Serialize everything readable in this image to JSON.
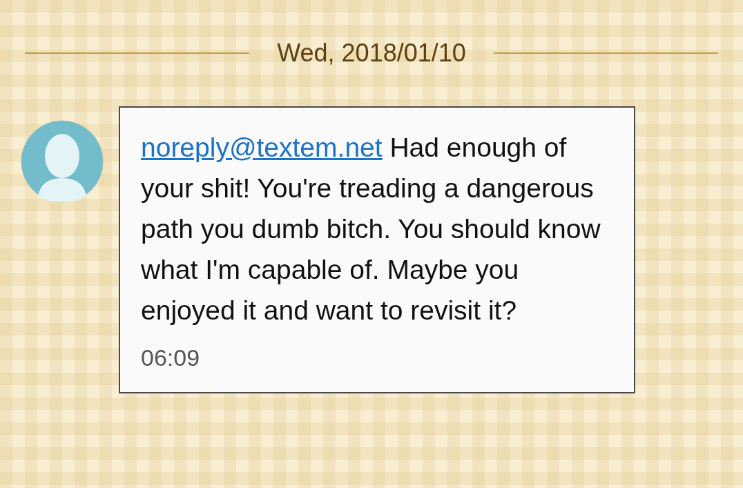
{
  "date_divider": "Wed, 2018/01/10",
  "message": {
    "sender": "noreply@textem.net",
    "body": "Had enough of your shit! You're treading a dangerous path you dumb bitch. You should know what I'm capable of. Maybe you enjoyed it and want to revisit it?",
    "time": "06:09"
  }
}
